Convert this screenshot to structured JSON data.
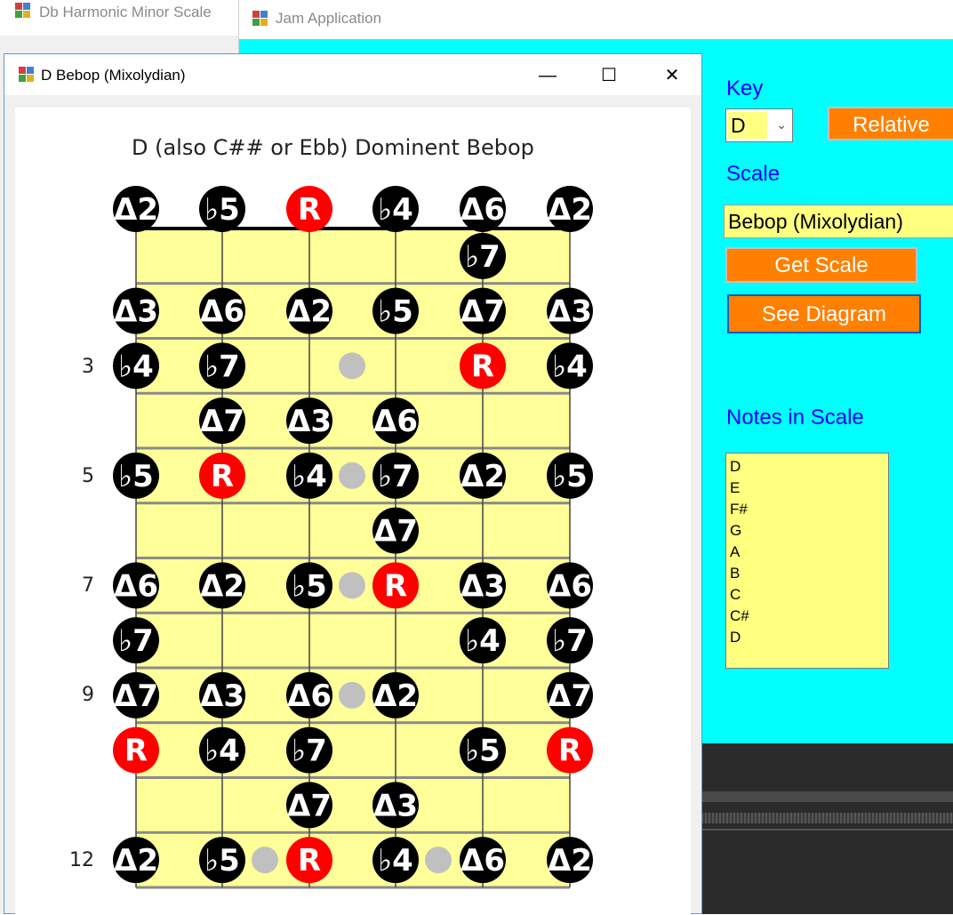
{
  "background_window": {
    "title": "Db Harmonic Minor Scale"
  },
  "jam_window": {
    "title": "Jam Application",
    "key_label": "Key",
    "key_value": "D",
    "relative_button": "Relative",
    "scale_label": "Scale",
    "scale_value": "Bebop (Mixolydian)",
    "get_scale_button": "Get Scale",
    "see_diagram_button": "See Diagram",
    "notes_label": "Notes in Scale",
    "notes": [
      "D",
      "E",
      "F#",
      "G",
      "A",
      "B",
      "C",
      "C#",
      "D"
    ]
  },
  "diagram_window": {
    "title": "D Bebop (Mixolydian)",
    "controls": {
      "minimize": "—",
      "maximize": "☐",
      "close": "✕"
    },
    "diagram_title": "D (also C## or Ebb) Dominent Bebop",
    "fret_numbers": [
      "3",
      "5",
      "7",
      "9",
      "12"
    ],
    "open_strings": [
      "Δ2",
      "♭5",
      "R",
      "♭4",
      "Δ6",
      "Δ2"
    ],
    "frets": [
      [
        null,
        null,
        null,
        null,
        "♭7",
        null
      ],
      [
        "Δ3",
        "Δ6",
        "Δ2",
        "♭5",
        "Δ7",
        "Δ3"
      ],
      [
        "♭4",
        "♭7",
        null,
        null,
        "R",
        "♭4"
      ],
      [
        null,
        "Δ7",
        "Δ3",
        "Δ6",
        null,
        null
      ],
      [
        "♭5",
        "R",
        "♭4",
        "♭7",
        "Δ2",
        "♭5"
      ],
      [
        null,
        null,
        null,
        "Δ7",
        null,
        null
      ],
      [
        "Δ6",
        "Δ2",
        "♭5",
        "R",
        "Δ3",
        "Δ6"
      ],
      [
        "♭7",
        null,
        null,
        null,
        "♭4",
        "♭7"
      ],
      [
        "Δ7",
        "Δ3",
        "Δ6",
        "Δ2",
        null,
        "Δ7"
      ],
      [
        "R",
        "♭4",
        "♭7",
        null,
        "♭5",
        "R"
      ],
      [
        null,
        null,
        "Δ7",
        "Δ3",
        null,
        null
      ],
      [
        "Δ2",
        "♭5",
        "R",
        "♭4",
        "Δ6",
        "Δ2"
      ]
    ],
    "colors": {
      "fretboard": "#ffff99",
      "root_note": "#ff0000",
      "note": "#000000",
      "inlay": "#c0c0c0"
    }
  }
}
